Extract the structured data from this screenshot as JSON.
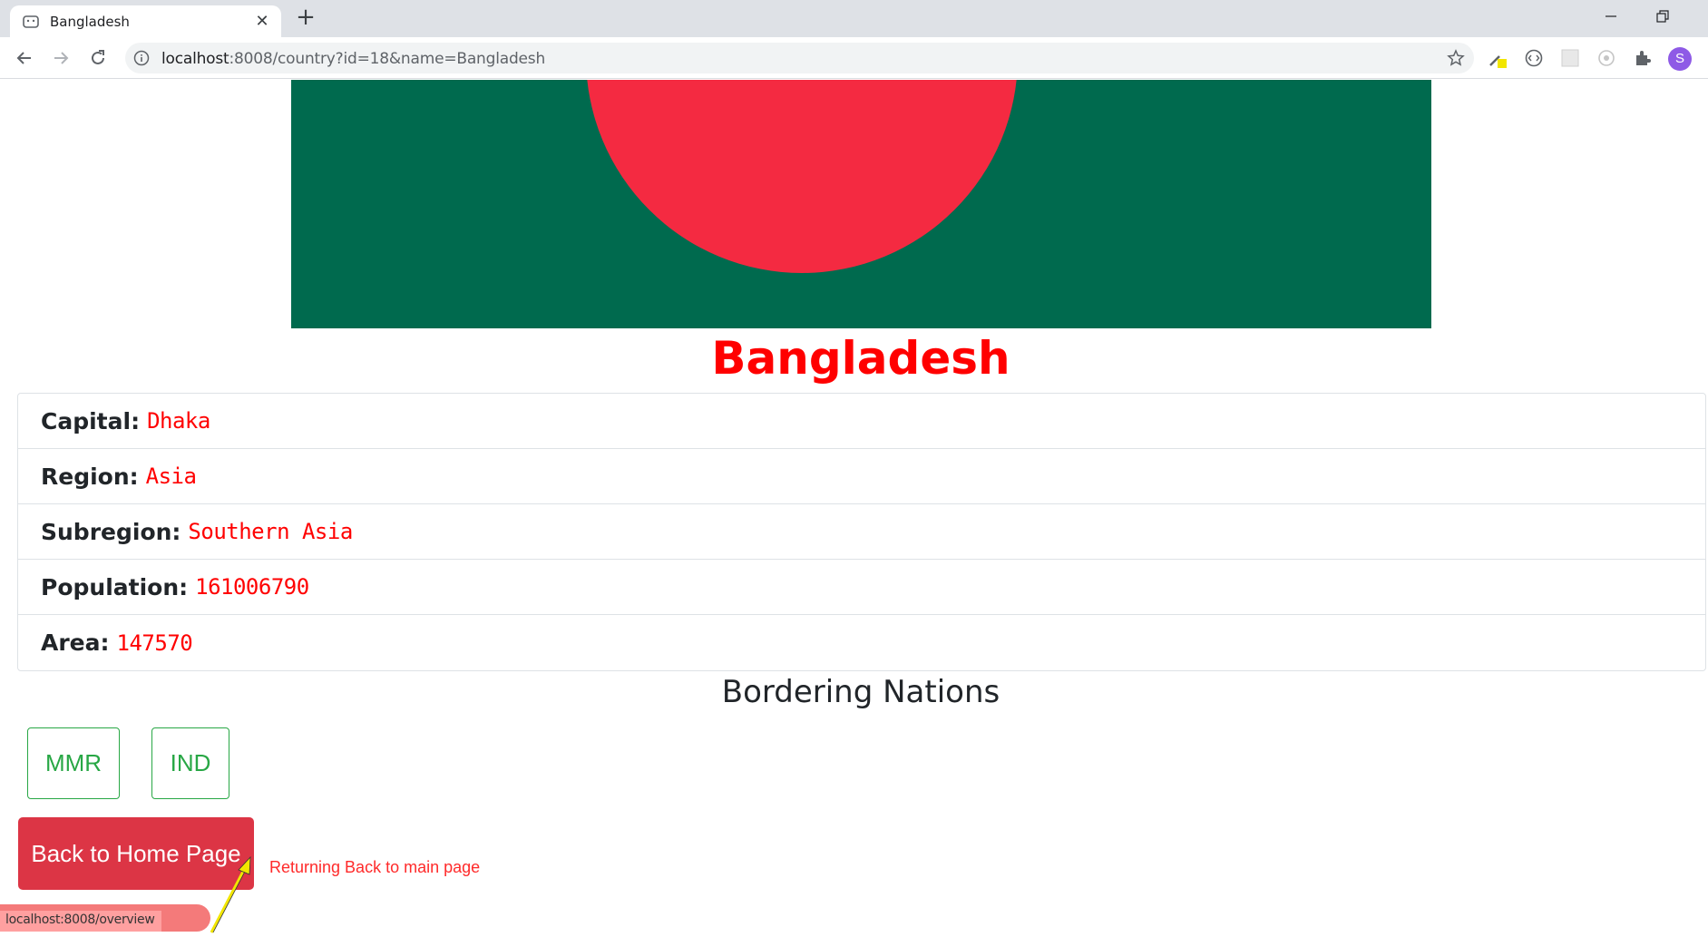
{
  "browser": {
    "tab_title": "Bangladesh",
    "url_host": "localhost",
    "url_rest": ":8008/country?id=18&name=Bangladesh",
    "avatar_letter": "S"
  },
  "country": {
    "name": "Bangladesh",
    "details": [
      {
        "label": "Capital:",
        "value": "Dhaka"
      },
      {
        "label": "Region:",
        "value": "Asia"
      },
      {
        "label": "Subregion:",
        "value": "Southern Asia"
      },
      {
        "label": "Population:",
        "value": "161006790"
      },
      {
        "label": "Area:",
        "value": "147570"
      }
    ],
    "borders_title": "Bordering Nations",
    "borders": [
      "MMR",
      "IND"
    ]
  },
  "home_button": "Back to Home Page",
  "annotation": "Returning Back to main page",
  "status_url": "localhost:8008/overview",
  "colors": {
    "flag_green": "#006a4e",
    "flag_red": "#f42a41",
    "accent_red": "#ff0000",
    "border_green": "#28a745",
    "danger": "#dc3545"
  }
}
